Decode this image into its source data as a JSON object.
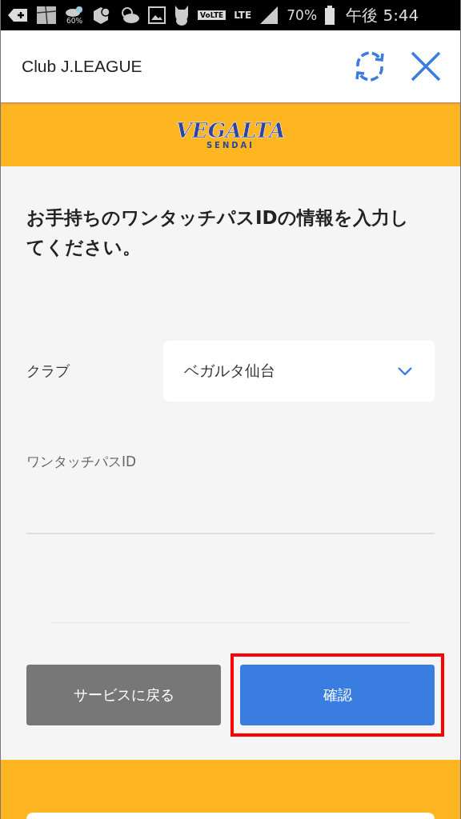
{
  "status_bar": {
    "weather_percent": "60%",
    "volte": "VoLTE",
    "network": "LTE",
    "battery": "70%",
    "time": "午後 5:44"
  },
  "header": {
    "title": "Club J.LEAGUE"
  },
  "logo": {
    "name": "VEGALTA",
    "subtitle": "SENDAI"
  },
  "form": {
    "heading": "お手持ちのワンタッチパスIDの情報を入力してください。",
    "club": {
      "label": "クラブ",
      "value": "ベガルタ仙台"
    },
    "pass_id": {
      "label": "ワンタッチパスID"
    }
  },
  "buttons": [
    {
      "label": "サービスに戻る",
      "kind": "secondary",
      "highlighted": false
    },
    {
      "label": "確認",
      "kind": "primary",
      "highlighted": true
    }
  ]
}
